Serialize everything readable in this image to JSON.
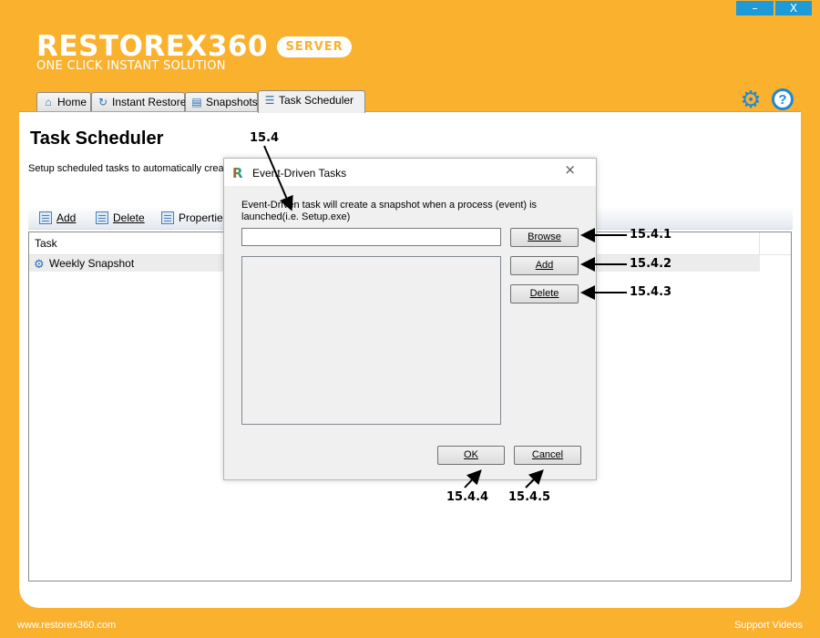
{
  "window": {
    "minimize": "–",
    "close": "X"
  },
  "brand": {
    "name": "RESTOREX360",
    "badge": "SERVER",
    "tagline": "ONE CLICK INSTANT SOLUTION"
  },
  "tabs": [
    {
      "label": "Home",
      "icon": "home-icon"
    },
    {
      "label": "Instant Restore",
      "icon": "restore-icon"
    },
    {
      "label": "Snapshots",
      "icon": "snapshots-icon"
    },
    {
      "label": "Task Scheduler",
      "icon": "scheduler-icon",
      "active": true
    }
  ],
  "page": {
    "title": "Task Scheduler",
    "description": "Setup scheduled tasks to automatically creat"
  },
  "toolbar": {
    "add": "Add",
    "delete": "Delete",
    "properties": "Properties"
  },
  "grid": {
    "columns": [
      "Task"
    ],
    "rows": [
      {
        "name": "Weekly Snapshot"
      }
    ]
  },
  "footer": {
    "website": "www.restorex360.com",
    "support": "Support Videos"
  },
  "dialog": {
    "title": "Event-Driven Tasks",
    "close": "×",
    "message": "Event-Driven task will create a snapshot when a process (event) is launched(i.e. Setup.exe)",
    "input_value": "",
    "browse": "Browse",
    "add": "Add",
    "delete": "Delete",
    "ok": "OK",
    "cancel": "Cancel"
  },
  "annotations": {
    "a1": "15.4",
    "a2": "15.4.1",
    "a3": "15.4.2",
    "a4": "15.4.3",
    "a5": "15.4.4",
    "a6": "15.4.5"
  },
  "colors": {
    "background": "#f9b12e",
    "accent": "#1e9ad6",
    "panel": "#ffffff"
  }
}
